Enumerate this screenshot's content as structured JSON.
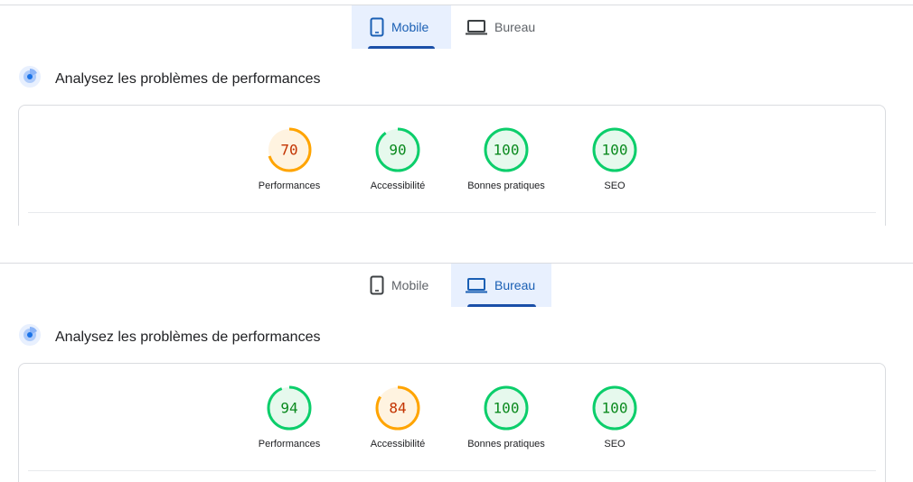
{
  "colors": {
    "good": "#0cce6b",
    "good_fill": "#e6f9ed",
    "good_text": "#0a8a1e",
    "average": "#ffa400",
    "average_fill": "#fff3e0",
    "average_text": "#c33300"
  },
  "reports": [
    {
      "tabs": {
        "mobile": {
          "label": "Mobile",
          "icon": "smartphone-icon",
          "active": true
        },
        "desktop": {
          "label": "Bureau",
          "icon": "laptop-icon",
          "active": false
        }
      },
      "heading": "Analysez les problèmes de performances",
      "scores": [
        {
          "label": "Performances",
          "value": 70,
          "rating": "average"
        },
        {
          "label": "Accessibilité",
          "value": 90,
          "rating": "good"
        },
        {
          "label": "Bonnes pratiques",
          "value": 100,
          "rating": "good"
        },
        {
          "label": "SEO",
          "value": 100,
          "rating": "good"
        }
      ]
    },
    {
      "tabs": {
        "mobile": {
          "label": "Mobile",
          "icon": "smartphone-icon",
          "active": false
        },
        "desktop": {
          "label": "Bureau",
          "icon": "laptop-icon",
          "active": true
        }
      },
      "heading": "Analysez les problèmes de performances",
      "scores": [
        {
          "label": "Performances",
          "value": 94,
          "rating": "good"
        },
        {
          "label": "Accessibilité",
          "value": 84,
          "rating": "average"
        },
        {
          "label": "Bonnes pratiques",
          "value": 100,
          "rating": "good"
        },
        {
          "label": "SEO",
          "value": 100,
          "rating": "good"
        }
      ]
    }
  ]
}
